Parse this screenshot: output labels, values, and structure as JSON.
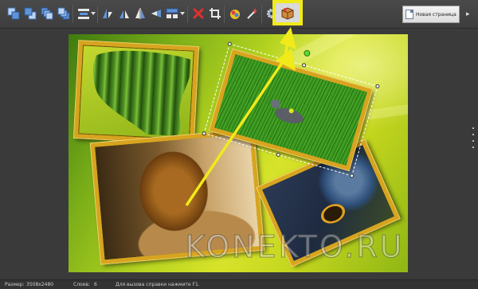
{
  "toolbar": {
    "new_page_label": "Новая страница",
    "scroll_arrow_glyph": "▸",
    "buttons": [
      {
        "name": "bring-to-front-icon",
        "color": "#7aa6e0"
      },
      {
        "name": "bring-forward-icon",
        "color": "#7aa6e0"
      },
      {
        "name": "send-backward-icon",
        "color": "#7aa6e0"
      },
      {
        "name": "send-to-back-icon",
        "color": "#7aa6e0"
      },
      {
        "name": "align-icon",
        "color": "#7aa6e0"
      },
      {
        "name": "flip-vertical-icon",
        "color": "#7aa6e0"
      },
      {
        "name": "flip-horizontal-icon",
        "color": "#7aa6e0"
      },
      {
        "name": "mirror-icon",
        "color": "#7aa6e0"
      },
      {
        "name": "distribute-icon",
        "color": "#7aa6e0"
      },
      {
        "name": "delete-icon",
        "color": "#e03030"
      },
      {
        "name": "crop-icon",
        "color": "#e8e8e8"
      },
      {
        "name": "effects-icon",
        "color": "#f0c020"
      },
      {
        "name": "magic-wand-icon",
        "color": "#e05050"
      },
      {
        "name": "settings-icon",
        "color": "#9ab0d0"
      },
      {
        "name": "photo-effects-box-icon",
        "color": "#c07a30"
      }
    ]
  },
  "canvas": {
    "watermark": "KONEKTO.RU"
  },
  "status_bar": {
    "size_label": "Размер:",
    "size_value": "3508x2480",
    "layers_label": "Слоев:",
    "layers_value": "6",
    "help_text": "Для вызова справки нажмите F1."
  },
  "colors": {
    "highlight": "#f1ea1a",
    "arrow": "#f1ea1a",
    "frame_gold": "#d8a41f"
  }
}
